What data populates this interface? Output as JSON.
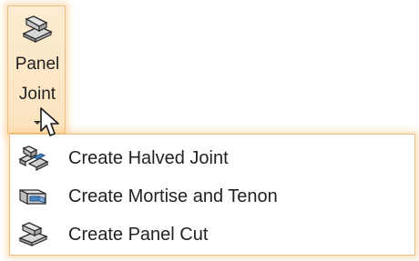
{
  "ribbon": {
    "button": {
      "label_line1": "Panel",
      "label_line2": "Joint",
      "icon": "panel-joint-icon",
      "state": "hover-pressed"
    }
  },
  "menu": {
    "items": [
      {
        "label": "Create Halved Joint",
        "icon": "halved-joint-icon"
      },
      {
        "label": "Create Mortise and Tenon",
        "icon": "mortise-tenon-icon"
      },
      {
        "label": "Create Panel Cut",
        "icon": "panel-cut-icon"
      }
    ]
  },
  "colors": {
    "highlight_border": "#e9c184",
    "highlight_glow": "#f6b45a",
    "button_fill": "#fdecd2",
    "icon_blue": "#4a86c5",
    "text": "#222222"
  }
}
